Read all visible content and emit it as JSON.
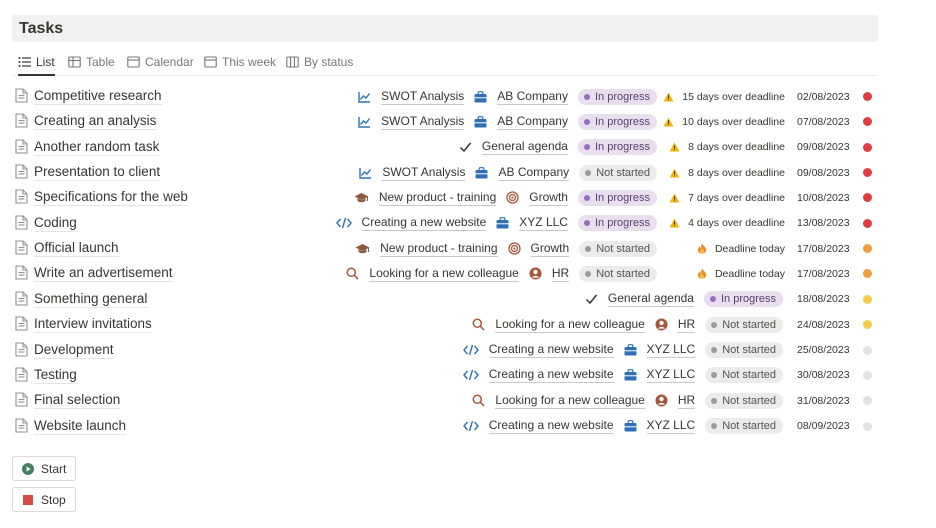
{
  "page": {
    "title": "Tasks"
  },
  "views": [
    {
      "label": "List",
      "icon": "list-icon"
    },
    {
      "label": "Table",
      "icon": "table-icon"
    },
    {
      "label": "Calendar",
      "icon": "calendar-icon"
    },
    {
      "label": "This week",
      "icon": "calendar-icon"
    },
    {
      "label": "By status",
      "icon": "board-icon"
    }
  ],
  "colors": {
    "overdue": "#e03e3e",
    "today": "#f29d38",
    "soon": "#f7c94b",
    "future": "#e3e2e0"
  },
  "tasks": [
    {
      "name": "Competitive research",
      "project": "SWOT Analysis",
      "project_icon": "chart-icon",
      "org": "AB Company",
      "org_icon": "briefcase-icon",
      "status": "In progress",
      "deadline": "15 days over deadline",
      "deadline_icon": "warning-icon",
      "date": "02/08/2023",
      "dot": "overdue"
    },
    {
      "name": "Creating an analysis",
      "project": "SWOT Analysis",
      "project_icon": "chart-icon",
      "org": "AB Company",
      "org_icon": "briefcase-icon",
      "status": "In progress",
      "deadline": "10 days over deadline",
      "deadline_icon": "warning-icon",
      "date": "07/08/2023",
      "dot": "overdue"
    },
    {
      "name": "Another random task",
      "project": "",
      "org": "General agenda",
      "org_icon": "check-icon",
      "status": "In progress",
      "deadline": "8 days over deadline",
      "deadline_icon": "warning-icon",
      "date": "09/08/2023",
      "dot": "overdue"
    },
    {
      "name": "Presentation to client",
      "project": "SWOT Analysis",
      "project_icon": "chart-icon",
      "org": "AB Company",
      "org_icon": "briefcase-icon",
      "status": "Not started",
      "deadline": "8 days over deadline",
      "deadline_icon": "warning-icon",
      "date": "09/08/2023",
      "dot": "overdue"
    },
    {
      "name": "Specifications for the web",
      "project": "New product - training",
      "project_icon": "graduation-cap-icon",
      "org": "Growth",
      "org_icon": "target-icon",
      "status": "In progress",
      "deadline": "7 days over deadline",
      "deadline_icon": "warning-icon",
      "date": "10/08/2023",
      "dot": "overdue"
    },
    {
      "name": "Coding",
      "project": "Creating a new website",
      "project_icon": "code-icon",
      "org": "XYZ LLC",
      "org_icon": "briefcase-icon",
      "status": "In progress",
      "deadline": "4 days over deadline",
      "deadline_icon": "warning-icon",
      "date": "13/08/2023",
      "dot": "overdue"
    },
    {
      "name": "Official launch",
      "project": "New product - training",
      "project_icon": "graduation-cap-icon",
      "org": "Growth",
      "org_icon": "target-icon",
      "status": "Not started",
      "deadline": "Deadline today",
      "deadline_icon": "fire-icon",
      "date": "17/08/2023",
      "dot": "today"
    },
    {
      "name": "Write an advertisement",
      "project": "Looking for a new colleague",
      "project_icon": "search-icon",
      "org": "HR",
      "org_icon": "person-icon",
      "status": "Not started",
      "deadline": "Deadline today",
      "deadline_icon": "fire-icon",
      "date": "17/08/2023",
      "dot": "today"
    },
    {
      "name": "Something general",
      "project": "",
      "org": "General agenda",
      "org_icon": "check-icon",
      "status": "In progress",
      "deadline": "",
      "date": "18/08/2023",
      "dot": "soon"
    },
    {
      "name": "Interview invitations",
      "project": "Looking for a new colleague",
      "project_icon": "search-icon",
      "org": "HR",
      "org_icon": "person-icon",
      "status": "Not started",
      "deadline": "",
      "date": "24/08/2023",
      "dot": "soon"
    },
    {
      "name": "Development",
      "project": "Creating a new website",
      "project_icon": "code-icon",
      "org": "XYZ LLC",
      "org_icon": "briefcase-icon",
      "status": "Not started",
      "deadline": "",
      "date": "25/08/2023",
      "dot": "future"
    },
    {
      "name": "Testing",
      "project": "Creating a new website",
      "project_icon": "code-icon",
      "org": "XYZ LLC",
      "org_icon": "briefcase-icon",
      "status": "Not started",
      "deadline": "",
      "date": "30/08/2023",
      "dot": "future"
    },
    {
      "name": "Final selection",
      "project": "Looking for a new colleague",
      "project_icon": "search-icon",
      "org": "HR",
      "org_icon": "person-icon",
      "status": "Not started",
      "deadline": "",
      "date": "31/08/2023",
      "dot": "future"
    },
    {
      "name": "Website launch",
      "project": "Creating a new website",
      "project_icon": "code-icon",
      "org": "XYZ LLC",
      "org_icon": "briefcase-icon",
      "status": "Not started",
      "deadline": "",
      "date": "08/09/2023",
      "dot": "future"
    }
  ],
  "buttons": [
    {
      "label": "Start",
      "icon": "play-icon"
    },
    {
      "label": "Stop",
      "icon": "stop-icon"
    }
  ]
}
